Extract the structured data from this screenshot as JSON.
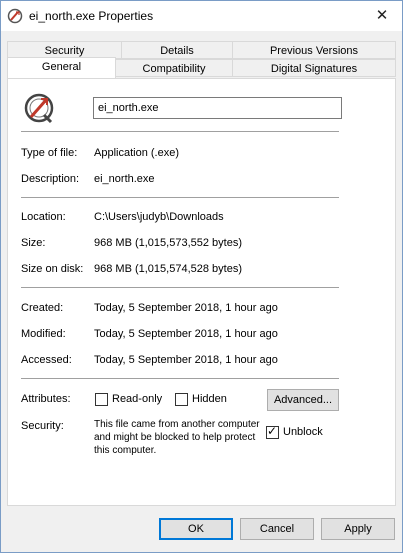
{
  "window": {
    "title": "ei_north.exe Properties",
    "close_glyph": "✕",
    "app_icon": "exe-app-icon"
  },
  "tabs_top": [
    "Security",
    "Details",
    "Previous Versions"
  ],
  "tabs_bottom": [
    "General",
    "Compatibility",
    "Digital Signatures"
  ],
  "active_tab": "General",
  "general": {
    "file_name": "ei_north.exe",
    "type_label": "Type of file:",
    "type_value": "Application (.exe)",
    "description_label": "Description:",
    "description_value": "ei_north.exe",
    "location_label": "Location:",
    "location_value": "C:\\Users\\judyb\\Downloads",
    "size_label": "Size:",
    "size_value": "968 MB (1,015,573,552 bytes)",
    "size_on_disk_label": "Size on disk:",
    "size_on_disk_value": "968 MB (1,015,574,528 bytes)",
    "created_label": "Created:",
    "created_value": "Today, 5 September 2018, 1 hour ago",
    "modified_label": "Modified:",
    "modified_value": "Today, 5 September 2018, 1 hour ago",
    "accessed_label": "Accessed:",
    "accessed_value": "Today, 5 September 2018, 1 hour ago",
    "attributes_label": "Attributes:",
    "readonly_label": "Read-only",
    "readonly_checked": false,
    "hidden_label": "Hidden",
    "hidden_checked": false,
    "advanced_button": "Advanced...",
    "security_label": "Security:",
    "security_text": "This file came from another computer and might be blocked to help protect this computer.",
    "unblock_label": "Unblock",
    "unblock_checked": true
  },
  "footer": {
    "ok": "OK",
    "cancel": "Cancel",
    "apply": "Apply"
  },
  "colors": {
    "accent": "#0078d7",
    "panel_bg": "#ffffff",
    "window_bg": "#f0f0f0"
  }
}
